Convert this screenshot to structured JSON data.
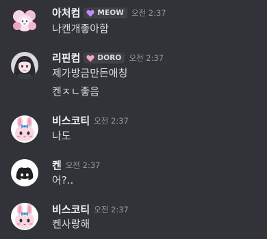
{
  "messages": [
    {
      "username": "아처컴",
      "tag": "MEOW",
      "tag_color": "#c58af9",
      "timestamp": "오전 2:37",
      "lines": [
        "나캔개좋아함"
      ],
      "avatar": "pink-fluffy-avatar-icon"
    },
    {
      "username": "리핀컴",
      "tag": "DORO",
      "tag_color": "#f5a3c7",
      "timestamp": "오전 2:37",
      "lines": [
        "제가방금만든애칭",
        "켄ㅈㄴ좋음"
      ],
      "avatar": "anime-girl-avatar-icon"
    },
    {
      "username": "비스코티",
      "timestamp": "오전 2:37",
      "lines": [
        "나도"
      ],
      "avatar": "pink-bunny-avatar-icon"
    },
    {
      "username": "켄",
      "timestamp": "오전 2:37",
      "lines": [
        "어?.."
      ],
      "avatar": "discord-logo-avatar-icon"
    },
    {
      "username": "비스코티",
      "timestamp": "오전 2:37",
      "lines": [
        "켄사랑해"
      ],
      "avatar": "pink-bunny-avatar-icon"
    }
  ]
}
